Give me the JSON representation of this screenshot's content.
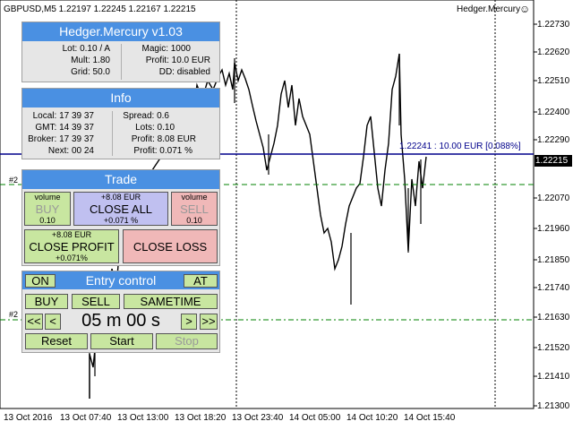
{
  "header": {
    "symbol_info": "GBPUSD,M5  1.22197 1.22245 1.22167 1.22215",
    "expert": "Hedger.Mercury",
    "smiley": "☺"
  },
  "price_axis": {
    "labels": [
      "1.22730",
      "1.22620",
      "1.22510",
      "1.22400",
      "1.22290",
      "1.22070",
      "1.21960",
      "1.21850",
      "1.21740",
      "1.21630",
      "1.21520",
      "1.21410",
      "1.21300"
    ],
    "current": "1.22215"
  },
  "time_axis": [
    "13 Oct 2016",
    "13 Oct 07:40",
    "13 Oct 13:00",
    "13 Oct 18:20",
    "13 Oct 23:40",
    "14 Oct 05:00",
    "14 Oct 10:20",
    "14 Oct 15:40"
  ],
  "chart_labels": {
    "level_label": "1.22241 : 10.00 EUR [0.088%]",
    "mark1": "#2",
    "mark2": "#2"
  },
  "hedger_panel": {
    "title": "Hedger.Mercury v1.03",
    "lot": "Lot: 0.10 / A",
    "mult": "Mult: 1.80",
    "grid": "Grid: 50.0",
    "magic": "Magic: 1000",
    "profit": "Profit: 10.0 EUR",
    "dd": "DD: disabled"
  },
  "info_panel": {
    "title": "Info",
    "local": "Local: 17 39 37",
    "gmt": "GMT: 14 39 37",
    "broker": "Broker: 17 39 37",
    "next": "Next: 00 24",
    "spread": "Spread: 0.6",
    "lots": "Lots: 0.10",
    "profit": "Profit: 8.08 EUR",
    "profit_pct": "Profit: 0.071 %"
  },
  "trade_panel": {
    "title": "Trade",
    "buy": {
      "top": "volume",
      "main": "BUY",
      "bottom": "0.10"
    },
    "close_all": {
      "top": "+8.08 EUR",
      "main": "CLOSE ALL",
      "bottom": "+0.071 %"
    },
    "sell": {
      "top": "volume",
      "main": "SELL",
      "bottom": "0.10"
    },
    "close_profit": {
      "top": "+8.08 EUR",
      "main": "CLOSE PROFIT",
      "bottom": "+0.071%"
    },
    "close_loss": {
      "main": "CLOSE LOSS"
    }
  },
  "entry_panel": {
    "on": "ON",
    "title": "Entry control",
    "at": "AT",
    "buy": "BUY",
    "sell": "SELL",
    "sametime": "SAMETIME",
    "rewind": "<<",
    "back": "<",
    "timer": "05 m 00 s",
    "fwd": ">",
    "ffwd": ">>",
    "reset": "Reset",
    "start": "Start",
    "stop": "Stop"
  },
  "colors": {
    "accent": "#4a90e2",
    "green_btn": "#c8e6a0",
    "purple_btn": "#c0c0f0",
    "pink_btn": "#f0b8b8",
    "level_line": "#00008b",
    "dashed_line": "#008000"
  }
}
